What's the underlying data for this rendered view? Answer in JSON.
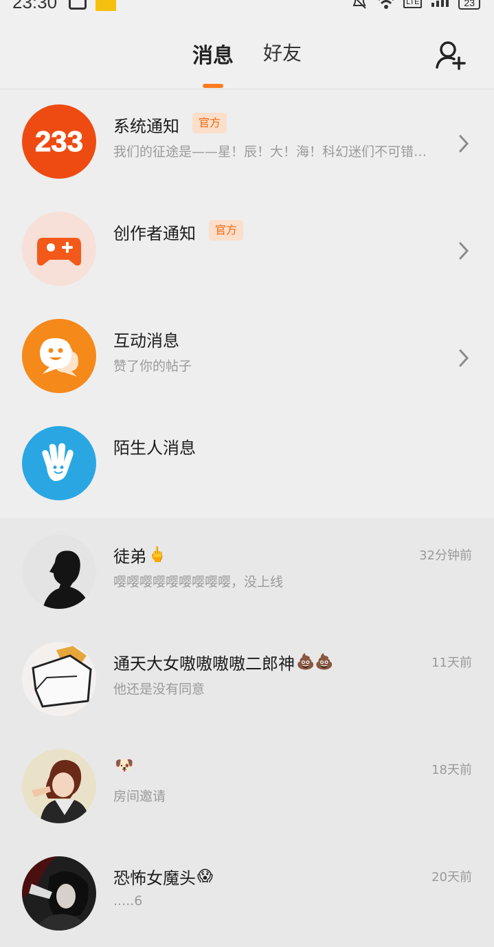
{
  "status_bar": {
    "time": "23:30",
    "network": "LTE",
    "battery": "23"
  },
  "tabs": [
    {
      "label": "消息",
      "active": true
    },
    {
      "label": "好友",
      "active": false
    }
  ],
  "accent_color": "#ff7a1f",
  "system_items": [
    {
      "title": "系统通知",
      "badge": "官方",
      "subtitle": "我们的征途是——星！辰！大！海！科幻迷们不可错…",
      "icon": "233-logo-icon",
      "color": "#ee4b12"
    },
    {
      "title": "创作者通知",
      "badge": "官方",
      "subtitle": "",
      "icon": "gamepad-icon",
      "color": "#f7e0d8"
    },
    {
      "title": "互动消息",
      "badge": "",
      "subtitle": "赞了你的帖子",
      "icon": "chat-bubble-icon",
      "color": "#f5891a"
    },
    {
      "title": "陌生人消息",
      "badge": "",
      "subtitle": "",
      "icon": "wave-hand-icon",
      "color": "#2aa7e3"
    }
  ],
  "chats": [
    {
      "name": "徒弟",
      "emoji": "🖕",
      "time": "32分钟前",
      "preview": "嘤嘤嘤嘤嘤嘤嘤嘤嘤，没上线"
    },
    {
      "name": "通天大女嗷嗷嗷嗷二郎神",
      "emoji": "💩💩",
      "time": "11天前",
      "preview": "他还是没有同意"
    },
    {
      "name": "",
      "emoji": "🐶",
      "time": "18天前",
      "preview": "房间邀请"
    },
    {
      "name": "恐怖女魔头",
      "emoji": "😱",
      "time": "20天前",
      "preview": ".....6"
    }
  ]
}
